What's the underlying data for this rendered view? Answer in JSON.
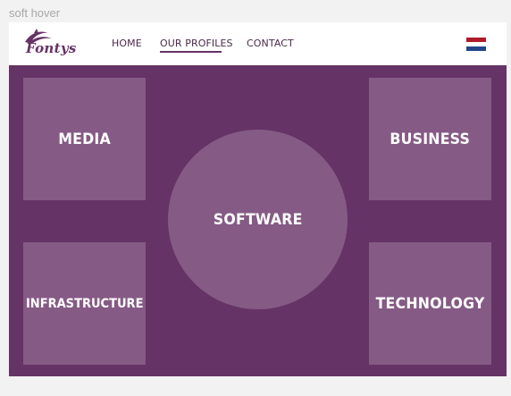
{
  "frame_label": "soft hover",
  "logo": {
    "text": "Fontys",
    "icon": "fontys-dolphin-icon"
  },
  "nav": {
    "home": "HOME",
    "profiles": "OUR PROFILES",
    "contact": "CONTACT",
    "active": "OUR PROFILES"
  },
  "language": {
    "flag": "netherlands-flag-icon",
    "colors": [
      "#AE1C28",
      "#FFFFFF",
      "#21468B"
    ]
  },
  "profiles": {
    "media": "MEDIA",
    "business": "BUSINESS",
    "software": "SOFTWARE",
    "infrastructure": "INFRASTRUCTURE",
    "technology": "TECHNOLOGY"
  },
  "colors": {
    "brand": "#663366",
    "tile": "#855A85",
    "background": "#F2F2F2"
  }
}
